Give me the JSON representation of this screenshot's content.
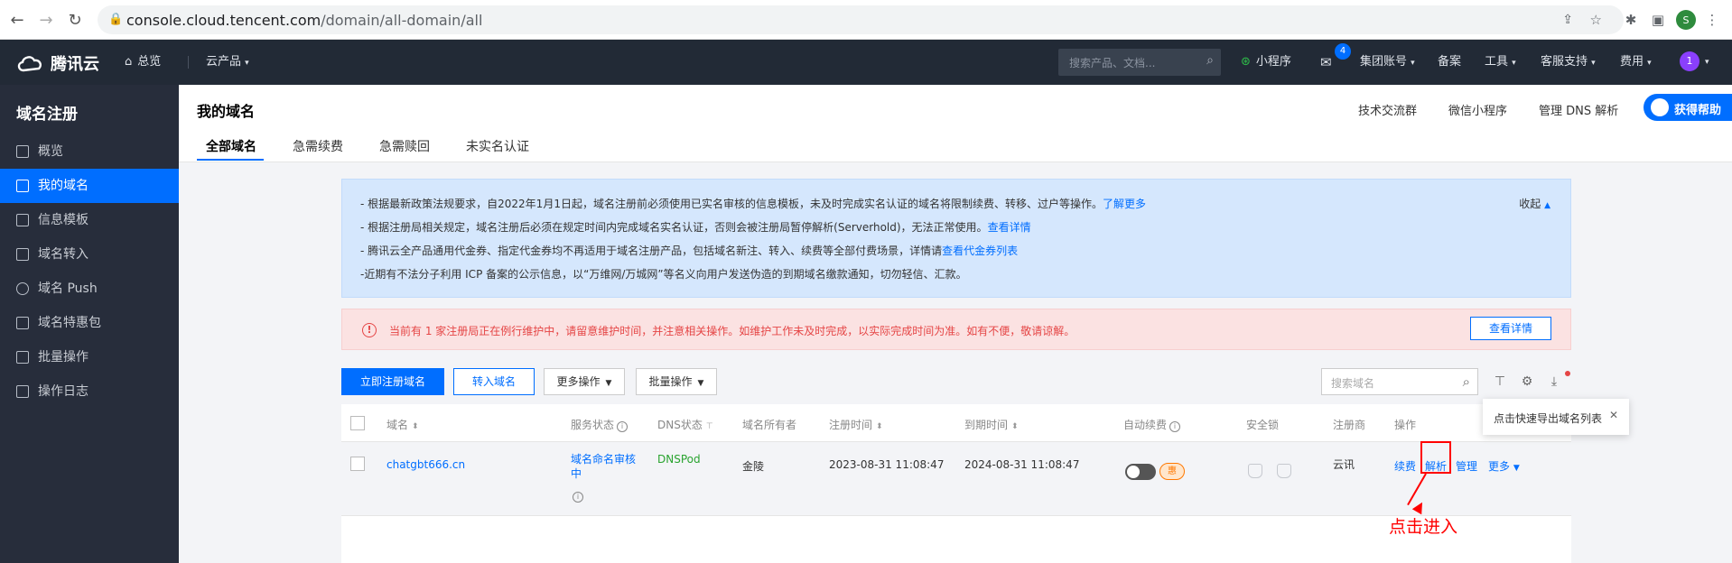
{
  "browser": {
    "url_host": "console.cloud.tencent.com",
    "url_path": "/domain/all-domain/all",
    "profile_initial": "S"
  },
  "topnav": {
    "brand": "腾讯云",
    "overview": "总览",
    "products": "云产品",
    "search_placeholder": "搜索产品、文档...",
    "miniprogram": "小程序",
    "mail_badge": "4",
    "group_account": "集团账号",
    "beian": "备案",
    "tools": "工具",
    "support": "客服支持",
    "fees": "费用",
    "user_initial": "1"
  },
  "sidebar": {
    "title": "域名注册",
    "items": [
      {
        "label": "概览"
      },
      {
        "label": "我的域名"
      },
      {
        "label": "信息模板"
      },
      {
        "label": "域名转入"
      },
      {
        "label": "域名 Push"
      },
      {
        "label": "域名特惠包"
      },
      {
        "label": "批量操作"
      },
      {
        "label": "操作日志"
      }
    ]
  },
  "header": {
    "title": "我的域名",
    "tabs": [
      "全部域名",
      "急需续费",
      "急需赎回",
      "未实名认证"
    ],
    "links": [
      "技术交流群",
      "微信小程序",
      "管理 DNS 解析"
    ],
    "help": "获得帮助"
  },
  "notice": {
    "lines": [
      {
        "text": "- 根据最新政策法规要求，自2022年1月1日起，域名注册前必须使用已实名审核的信息模板，未及时完成实名认证的域名将限制续费、转移、过户等操作。",
        "link": "了解更多"
      },
      {
        "text": "- 根据注册局相关规定，域名注册后必须在规定时间内完成域名实名认证，否则会被注册局暂停解析(Serverhold)，无法正常使用。",
        "link": "查看详情"
      },
      {
        "text": "- 腾讯云全产品通用代金券、指定代金券均不再适用于域名注册产品，包括域名新注、转入、续费等全部付费场景，详情请",
        "link": "查看代金券列表"
      },
      {
        "text": "-近期有不法分子利用 ICP 备案的公示信息，以“万维网/万城网”等名义向用户发送伪造的到期域名缴款通知，切勿轻信、汇款。",
        "link": ""
      }
    ],
    "collapse": "收起"
  },
  "warning": {
    "text": "当前有 1 家注册局正在例行维护中，请留意维护时间，并注意相关操作。如维护工作未及时完成，以实际完成时间为准。如有不便，敬请谅解。",
    "button": "查看详情"
  },
  "toolbar": {
    "register": "立即注册域名",
    "transfer": "转入域名",
    "more_ops": "更多操作",
    "batch_ops": "批量操作",
    "search_placeholder": "搜索域名",
    "tooltip": "点击快速导出域名列表"
  },
  "table": {
    "headers": {
      "domain": "域名",
      "service_status": "服务状态",
      "dns_status": "DNS状态",
      "owner": "域名所有者",
      "reg_time": "注册时间",
      "exp_time": "到期时间",
      "auto_renew": "自动续费",
      "lock": "安全锁",
      "registrar": "注册商",
      "actions": "操作"
    },
    "row": {
      "domain": "chatgbt666.cn",
      "status_line1": "域名命名审核",
      "status_line2": "中",
      "dns": "DNSPod",
      "owner": "金陵",
      "reg_time": "2023-08-31 11:08:47",
      "exp_time": "2024-08-31 11:08:47",
      "renew_tag": "惠",
      "registrar": "云讯",
      "act_renew": "续费",
      "act_resolve": "解析",
      "act_manage": "管理",
      "act_more": "更多"
    }
  },
  "annotation": "点击进入",
  "colors": {
    "accent": "#006eff",
    "nav_bg": "#222a36",
    "sidebar_bg": "#272d3b",
    "warn": "#e54545",
    "annotation": "#ff0000"
  }
}
